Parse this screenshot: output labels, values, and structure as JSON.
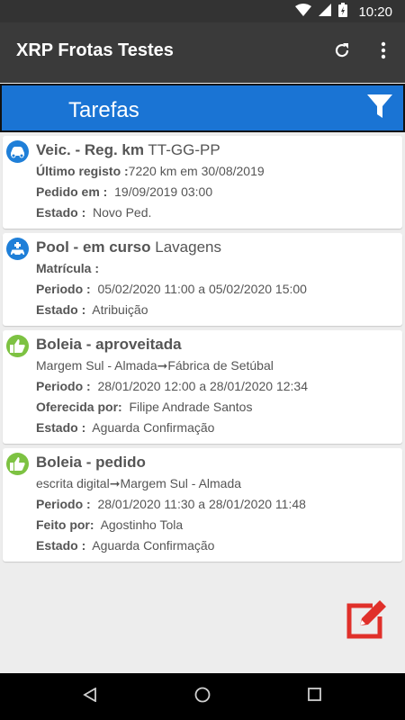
{
  "status_bar": {
    "time": "10:20"
  },
  "app_bar": {
    "title": "XRP Frotas Testes"
  },
  "header": {
    "title": "Tarefas"
  },
  "colors": {
    "app_bar": "#3a3a3a",
    "header": "#1a74d4",
    "icon_blue": "#1f7fd8",
    "icon_green": "#7dc242",
    "fab": "#e0302a"
  },
  "tasks": [
    {
      "icon": "car-icon",
      "title": "Veic. - Reg. km",
      "subtitle": "TT-GG-PP",
      "l1_label": "Último registo :",
      "l1_value": "7220 km em 30/08/2019",
      "l2_label": "Pedido em :",
      "l2_value": "19/09/2019 03:00",
      "l3_label": "Estado :",
      "l3_value": "Novo Ped."
    },
    {
      "icon": "car-plus-icon",
      "title": "Pool - em curso",
      "subtitle": "Lavagens",
      "l1_label": "Matrícula :",
      "l1_value": "",
      "l2_label": "Periodo :",
      "l2_value": "05/02/2020 11:00 a  05/02/2020 15:00",
      "l3_label": "Estado :",
      "l3_value": "Atribuição"
    },
    {
      "icon": "thumbs-up-icon",
      "title": "Boleia - aproveitada",
      "route_from": "Margem Sul - Almada",
      "route_to": "Fábrica de Setúbal",
      "l2_label": "Periodo :",
      "l2_value": "28/01/2020 12:00 a  28/01/2020 12:34",
      "l3_label": "Oferecida por:",
      "l3_value": "Filipe Andrade Santos",
      "l4_label": "Estado :",
      "l4_value": "Aguarda Confirmação"
    },
    {
      "icon": "thumbs-up-icon",
      "title": "Boleia - pedido",
      "route_from": "escrita digital",
      "route_to": "Margem Sul - Almada",
      "l2_label": "Periodo :",
      "l2_value": "28/01/2020 11:30 a  28/01/2020 11:48",
      "l3_label": "Feito por:",
      "l3_value": "Agostinho Tola",
      "l4_label": "Estado :",
      "l4_value": "Aguarda Confirmação"
    }
  ]
}
